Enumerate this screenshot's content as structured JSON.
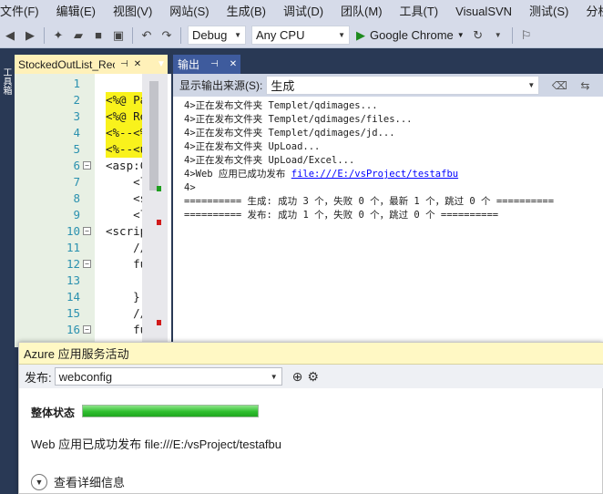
{
  "menu": [
    "文件(F)",
    "编辑(E)",
    "视图(V)",
    "网站(S)",
    "生成(B)",
    "调试(D)",
    "团队(M)",
    "工具(T)",
    "VisualSVN",
    "测试(S)",
    "分析(N)"
  ],
  "toolbar": {
    "config": "Debug",
    "platform": "Any CPU",
    "browser": "Google Chrome"
  },
  "toolbox_label": "工具箱",
  "editor": {
    "tab_label": "StockedOutList_Rec",
    "lines": [
      {
        "n": "1",
        "text": ""
      },
      {
        "n": "2",
        "text": "<%@ Page"
      },
      {
        "n": "3",
        "text": "<%@ Regi"
      },
      {
        "n": "4",
        "text": "<%--<%@"
      },
      {
        "n": "5",
        "text": "<%--<ucS"
      },
      {
        "n": "6",
        "text": "<asp:Con"
      },
      {
        "n": "7",
        "text": "    <lin"
      },
      {
        "n": "8",
        "text": "    <scr"
      },
      {
        "n": "9",
        "text": "    <lin"
      },
      {
        "n": "10",
        "text": "<script"
      },
      {
        "n": "11",
        "text": "    //去"
      },
      {
        "n": "12",
        "text": "    func"
      },
      {
        "n": "13",
        "text": ""
      },
      {
        "n": "14",
        "text": "    }"
      },
      {
        "n": "15",
        "text": "    //去"
      },
      {
        "n": "16",
        "text": "    func"
      }
    ]
  },
  "output": {
    "tab_label": "输出",
    "source_label": "显示输出来源(S):",
    "source_value": "生成",
    "lines": [
      "4>正在发布文件夹 Templet/qdimages...",
      "4>正在发布文件夹 Templet/qdimages/files...",
      "4>正在发布文件夹 Templet/qdimages/jd...",
      "4>正在发布文件夹 UpLoad...",
      "4>正在发布文件夹 UpLoad/Excel...",
      "4>Web 应用已成功发布 ",
      "4>",
      "========== 生成: 成功 3 个，失败 0 个，最新 1 个，跳过 0 个 ==========",
      "========== 发布: 成功 1 个，失败 0 个，跳过 0 个 =========="
    ],
    "link": "file:///E:/vsProject/testafbu"
  },
  "azure": {
    "title": "Azure 应用服务活动",
    "publish_label": "发布:",
    "publish_value": "webconfig",
    "status_label": "整体状态",
    "progress": 1.0,
    "message": "Web 应用已成功发布 file:///E:/vsProject/testafbu",
    "details_label": "查看详细信息"
  },
  "colors": {
    "chrome": "#d6dbe9",
    "dark": "#293955",
    "tab_active": "#fff1b9",
    "progress": "#2fbf2f"
  }
}
